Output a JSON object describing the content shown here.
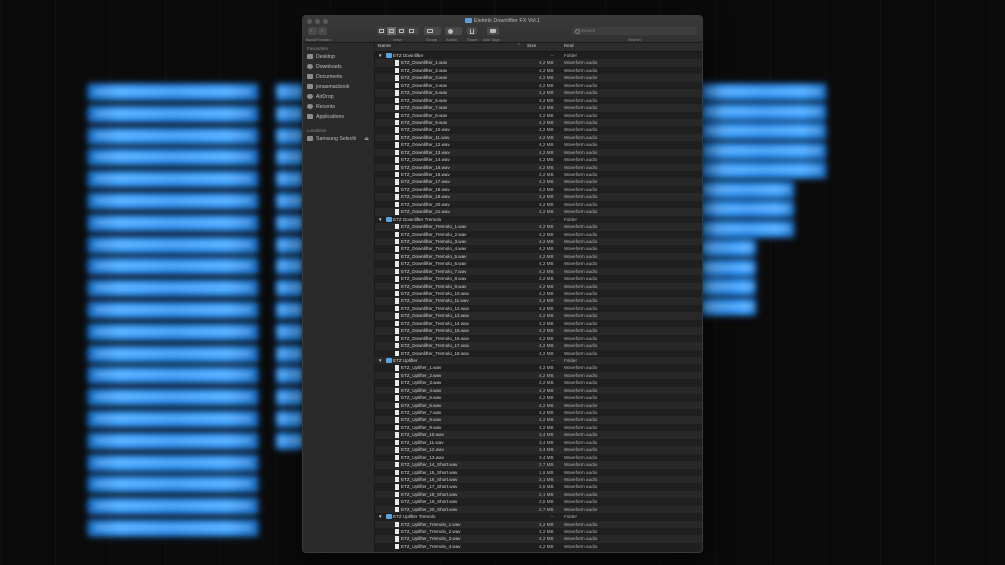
{
  "window": {
    "title": "Elektrik Downlifter FX Vol.1",
    "toolbar": {
      "nav_label": "Back/Forward",
      "view_label": "View",
      "group_label": "Group",
      "action_label": "Action",
      "share_label": "Share",
      "tags_label": "Add Tags",
      "search_label": "Search",
      "search_placeholder": "Search"
    }
  },
  "sidebar": {
    "favorites_header": "Favourites",
    "favorites": [
      {
        "label": "Desktop",
        "icon": "desktop-icon"
      },
      {
        "label": "Downloads",
        "icon": "downloads-icon"
      },
      {
        "label": "Documents",
        "icon": "documents-icon"
      },
      {
        "label": "jonasmacbook",
        "icon": "home-icon"
      },
      {
        "label": "AirDrop",
        "icon": "airdrop-icon"
      },
      {
        "label": "Recents",
        "icon": "recents-icon"
      },
      {
        "label": "Applications",
        "icon": "applications-icon"
      }
    ],
    "locations_header": "Locations",
    "locations": [
      {
        "label": "Samsung Selechi",
        "icon": "drive-icon",
        "eject": "⏏"
      }
    ]
  },
  "columns": {
    "name": "Name",
    "size": "Size",
    "kind": "Kind"
  },
  "rows": [
    {
      "type": "folder",
      "name": "ETZ Downlifter",
      "size": "--",
      "kind": "Folder"
    },
    {
      "type": "file",
      "name": "ETZ_Downlifter_1.wav",
      "size": "4,2 MB",
      "kind": "Waveform audio"
    },
    {
      "type": "file",
      "name": "ETZ_Downlifter_2.wav",
      "size": "4,2 MB",
      "kind": "Waveform audio"
    },
    {
      "type": "file",
      "name": "ETZ_Downlifter_3.wav",
      "size": "4,2 MB",
      "kind": "Waveform audio"
    },
    {
      "type": "file",
      "name": "ETZ_Downlifter_4.wav",
      "size": "4,2 MB",
      "kind": "Waveform audio"
    },
    {
      "type": "file",
      "name": "ETZ_Downlifter_5.wav",
      "size": "4,2 MB",
      "kind": "Waveform audio"
    },
    {
      "type": "file",
      "name": "ETZ_Downlifter_6.wav",
      "size": "4,2 MB",
      "kind": "Waveform audio"
    },
    {
      "type": "file",
      "name": "ETZ_Downlifter_7.wav",
      "size": "4,2 MB",
      "kind": "Waveform audio"
    },
    {
      "type": "file",
      "name": "ETZ_Downlifter_8.wav",
      "size": "4,2 MB",
      "kind": "Waveform audio"
    },
    {
      "type": "file",
      "name": "ETZ_Downlifter_9.wav",
      "size": "4,2 MB",
      "kind": "Waveform audio"
    },
    {
      "type": "file",
      "name": "ETZ_Downlifter_10.wav",
      "size": "4,2 MB",
      "kind": "Waveform audio"
    },
    {
      "type": "file",
      "name": "ETZ_Downlifter_11.wav",
      "size": "4,2 MB",
      "kind": "Waveform audio"
    },
    {
      "type": "file",
      "name": "ETZ_Downlifter_12.wav",
      "size": "4,2 MB",
      "kind": "Waveform audio"
    },
    {
      "type": "file",
      "name": "ETZ_Downlifter_13.wav",
      "size": "4,2 MB",
      "kind": "Waveform audio"
    },
    {
      "type": "file",
      "name": "ETZ_Downlifter_14.wav",
      "size": "4,2 MB",
      "kind": "Waveform audio"
    },
    {
      "type": "file",
      "name": "ETZ_Downlifter_15.wav",
      "size": "4,2 MB",
      "kind": "Waveform audio"
    },
    {
      "type": "file",
      "name": "ETZ_Downlifter_16.wav",
      "size": "4,2 MB",
      "kind": "Waveform audio"
    },
    {
      "type": "file",
      "name": "ETZ_Downlifter_17.wav",
      "size": "4,2 MB",
      "kind": "Waveform audio"
    },
    {
      "type": "file",
      "name": "ETZ_Downlifter_18.wav",
      "size": "4,2 MB",
      "kind": "Waveform audio"
    },
    {
      "type": "file",
      "name": "ETZ_Downlifter_19.wav",
      "size": "4,2 MB",
      "kind": "Waveform audio"
    },
    {
      "type": "file",
      "name": "ETZ_Downlifter_20.wav",
      "size": "4,2 MB",
      "kind": "Waveform audio"
    },
    {
      "type": "file",
      "name": "ETZ_Downlifter_21.wav",
      "size": "4,2 MB",
      "kind": "Waveform audio"
    },
    {
      "type": "folder",
      "name": "ETZ Downlifter Tremolo",
      "size": "--",
      "kind": "Folder"
    },
    {
      "type": "file",
      "name": "ETZ_Downlifter_Tremolo_1.wav",
      "size": "4,2 MB",
      "kind": "Waveform audio"
    },
    {
      "type": "file",
      "name": "ETZ_Downlifter_Tremolo_2.wav",
      "size": "4,2 MB",
      "kind": "Waveform audio"
    },
    {
      "type": "file",
      "name": "ETZ_Downlifter_Tremolo_3.wav",
      "size": "4,2 MB",
      "kind": "Waveform audio"
    },
    {
      "type": "file",
      "name": "ETZ_Downlifter_Tremolo_4.wav",
      "size": "4,2 MB",
      "kind": "Waveform audio"
    },
    {
      "type": "file",
      "name": "ETZ_Downlifter_Tremolo_5.wav",
      "size": "4,2 MB",
      "kind": "Waveform audio"
    },
    {
      "type": "file",
      "name": "ETZ_Downlifter_Tremolo_6.wav",
      "size": "4,2 MB",
      "kind": "Waveform audio"
    },
    {
      "type": "file",
      "name": "ETZ_Downlifter_Tremolo_7.wav",
      "size": "4,2 MB",
      "kind": "Waveform audio"
    },
    {
      "type": "file",
      "name": "ETZ_Downlifter_Tremolo_8.wav",
      "size": "4,2 MB",
      "kind": "Waveform audio"
    },
    {
      "type": "file",
      "name": "ETZ_Downlifter_Tremolo_9.wav",
      "size": "4,2 MB",
      "kind": "Waveform audio"
    },
    {
      "type": "file",
      "name": "ETZ_Downlifter_Tremolo_10.wav",
      "size": "4,2 MB",
      "kind": "Waveform audio"
    },
    {
      "type": "file",
      "name": "ETZ_Downlifter_Tremolo_11.wav",
      "size": "4,2 MB",
      "kind": "Waveform audio"
    },
    {
      "type": "file",
      "name": "ETZ_Downlifter_Tremolo_12.wav",
      "size": "4,2 MB",
      "kind": "Waveform audio"
    },
    {
      "type": "file",
      "name": "ETZ_Downlifter_Tremolo_13.wav",
      "size": "4,2 MB",
      "kind": "Waveform audio"
    },
    {
      "type": "file",
      "name": "ETZ_Downlifter_Tremolo_14.wav",
      "size": "4,2 MB",
      "kind": "Waveform audio"
    },
    {
      "type": "file",
      "name": "ETZ_Downlifter_Tremolo_15.wav",
      "size": "4,2 MB",
      "kind": "Waveform audio"
    },
    {
      "type": "file",
      "name": "ETZ_Downlifter_Tremolo_16.wav",
      "size": "4,2 MB",
      "kind": "Waveform audio"
    },
    {
      "type": "file",
      "name": "ETZ_Downlifter_Tremolo_17.wav",
      "size": "4,2 MB",
      "kind": "Waveform audio"
    },
    {
      "type": "file",
      "name": "ETZ_Downlifter_Tremolo_18.wav",
      "size": "4,2 MB",
      "kind": "Waveform audio"
    },
    {
      "type": "folder",
      "name": "ETZ Uplifter",
      "size": "--",
      "kind": "Folder"
    },
    {
      "type": "file",
      "name": "ETZ_Uplifter_1.wav",
      "size": "4,2 MB",
      "kind": "Waveform audio"
    },
    {
      "type": "file",
      "name": "ETZ_Uplifter_2.wav",
      "size": "4,2 MB",
      "kind": "Waveform audio"
    },
    {
      "type": "file",
      "name": "ETZ_Uplifter_3.wav",
      "size": "4,2 MB",
      "kind": "Waveform audio"
    },
    {
      "type": "file",
      "name": "ETZ_Uplifter_4.wav",
      "size": "4,2 MB",
      "kind": "Waveform audio"
    },
    {
      "type": "file",
      "name": "ETZ_Uplifter_5.wav",
      "size": "4,2 MB",
      "kind": "Waveform audio"
    },
    {
      "type": "file",
      "name": "ETZ_Uplifter_6.wav",
      "size": "4,2 MB",
      "kind": "Waveform audio"
    },
    {
      "type": "file",
      "name": "ETZ_Uplifter_7.wav",
      "size": "4,2 MB",
      "kind": "Waveform audio"
    },
    {
      "type": "file",
      "name": "ETZ_Uplifter_8.wav",
      "size": "4,2 MB",
      "kind": "Waveform audio"
    },
    {
      "type": "file",
      "name": "ETZ_Uplifter_9.wav",
      "size": "4,2 MB",
      "kind": "Waveform audio"
    },
    {
      "type": "file",
      "name": "ETZ_Uplifter_10.wav",
      "size": "3,4 MB",
      "kind": "Waveform audio"
    },
    {
      "type": "file",
      "name": "ETZ_Uplifter_11.wav",
      "size": "3,4 MB",
      "kind": "Waveform audio"
    },
    {
      "type": "file",
      "name": "ETZ_Uplifter_12.wav",
      "size": "3,4 MB",
      "kind": "Waveform audio"
    },
    {
      "type": "file",
      "name": "ETZ_Uplifter_13.wav",
      "size": "3,4 MB",
      "kind": "Waveform audio"
    },
    {
      "type": "file",
      "name": "ETZ_Uplifter_14_Short.wav",
      "size": "2,7 MB",
      "kind": "Waveform audio"
    },
    {
      "type": "file",
      "name": "ETZ_Uplifter_15_Short.wav",
      "size": "1,6 MB",
      "kind": "Waveform audio"
    },
    {
      "type": "file",
      "name": "ETZ_Uplifter_16_Short.wav",
      "size": "2,1 MB",
      "kind": "Waveform audio"
    },
    {
      "type": "file",
      "name": "ETZ_Uplifter_17_Short.wav",
      "size": "2,5 MB",
      "kind": "Waveform audio"
    },
    {
      "type": "file",
      "name": "ETZ_Uplifter_18_Short.wav",
      "size": "2,1 MB",
      "kind": "Waveform audio"
    },
    {
      "type": "file",
      "name": "ETZ_Uplifter_19_Short.wav",
      "size": "2,5 MB",
      "kind": "Waveform audio"
    },
    {
      "type": "file",
      "name": "ETZ_Uplifter_20_Short.wav",
      "size": "2,7 MB",
      "kind": "Waveform audio"
    },
    {
      "type": "folder",
      "name": "ETZ Uplifter Tremolo",
      "size": "--",
      "kind": "Folder"
    },
    {
      "type": "file",
      "name": "ETZ_Uplifter_Tremolo_1.wav",
      "size": "4,2 MB",
      "kind": "Waveform audio"
    },
    {
      "type": "file",
      "name": "ETZ_Uplifter_Tremolo_2.wav",
      "size": "4,2 MB",
      "kind": "Waveform audio"
    },
    {
      "type": "file",
      "name": "ETZ_Uplifter_Tremolo_3.wav",
      "size": "4,2 MB",
      "kind": "Waveform audio"
    },
    {
      "type": "file",
      "name": "ETZ_Uplifter_Tremolo_4.wav",
      "size": "4,2 MB",
      "kind": "Waveform audio"
    }
  ],
  "colors": {
    "accent_blue": "#2a8ef0",
    "folder_blue": "#5ba3df",
    "window_bg": "#232323"
  }
}
